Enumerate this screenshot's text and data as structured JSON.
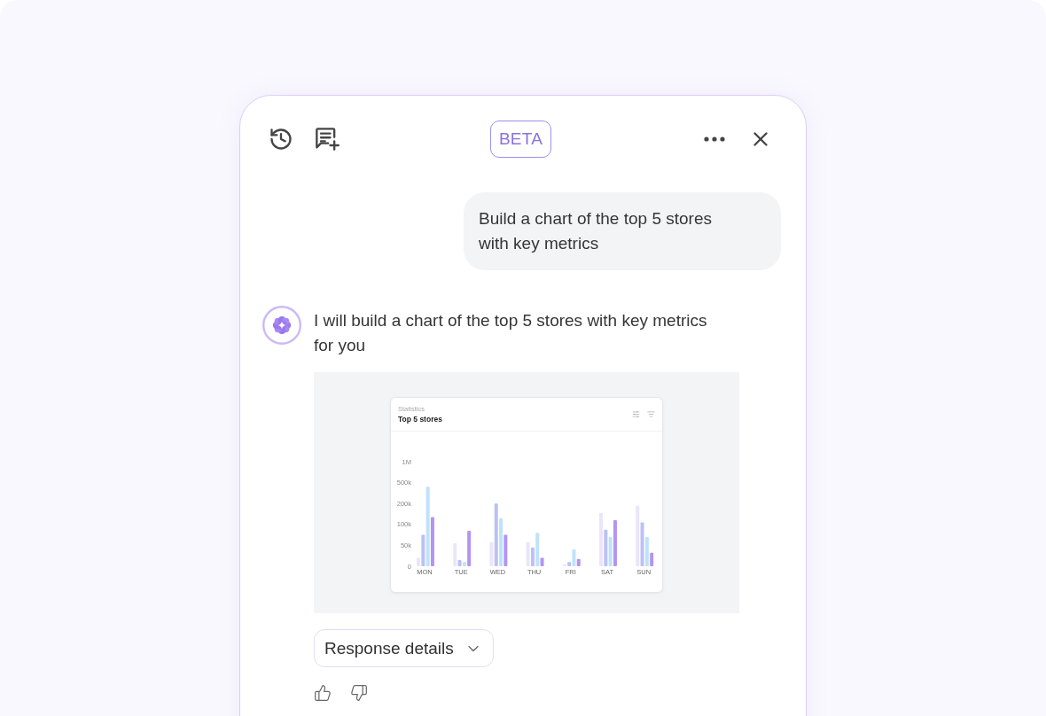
{
  "header": {
    "badge": "BETA"
  },
  "messages": [
    {
      "kind": "user",
      "text": "Build a chart of the top 5 stores with key metrics"
    },
    {
      "kind": "assistant",
      "text": "I will build a chart of the top 5 stores with key metrics for you",
      "attachment": {
        "subtitle": "Statistics",
        "title": "Top 5 stores",
        "y_axis_labels": [
          "1M",
          "500k",
          "200k",
          "100k",
          "50k",
          "0"
        ],
        "x_axis_labels": [
          "MON",
          "TUE",
          "WED",
          "THU",
          "FRI",
          "SAT",
          "SUN"
        ]
      },
      "details_button": {
        "label": "Response details",
        "expanded": false
      }
    }
  ]
}
